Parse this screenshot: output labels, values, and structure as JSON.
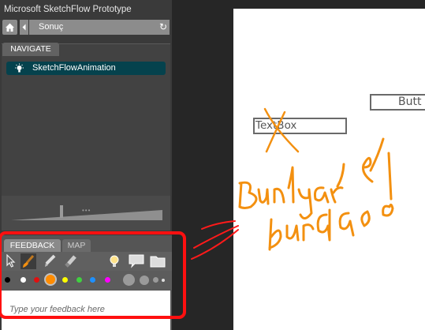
{
  "window": {
    "title": "Microsoft SketchFlow Prototype"
  },
  "navigation_bar": {
    "address": "Sonuç",
    "icons": [
      "home-icon",
      "back-arrow-icon",
      "refresh-icon"
    ]
  },
  "navigate_panel": {
    "tab_label": "NAVIGATE",
    "items": [
      {
        "label": "SketchFlowAnimation",
        "icon": "lightbulb-icon"
      }
    ]
  },
  "feedback_panel": {
    "tabs": [
      "FEEDBACK",
      "MAP"
    ],
    "tools": [
      "select-arrow-icon",
      "brush-icon",
      "highlighter-icon",
      "eraser-icon",
      "lightbulb-icon",
      "speech-bubble-icon",
      "folder-icon"
    ],
    "colors": [
      "#000000",
      "#ffffff",
      "#e01010",
      "#ff8c00",
      "#ffff00",
      "#40d040",
      "#1e90ff",
      "#ff00ff"
    ],
    "selected_color": "#ff8c00",
    "placeholder": "Type your feedback here"
  },
  "canvas": {
    "textbox_label": "TextBox",
    "button_label": "Butt",
    "annotation_handwriting": "Bunlar burada o"
  },
  "colors": {
    "accent_orange": "#f39010",
    "highlight_red": "#ff1010",
    "nav_item_bg": "#05424d"
  }
}
